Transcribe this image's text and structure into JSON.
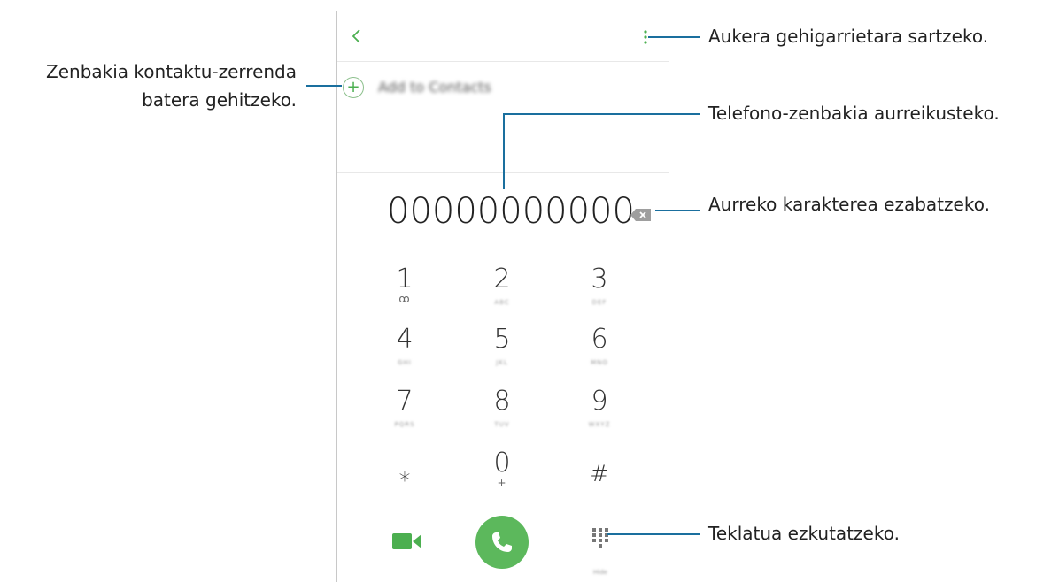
{
  "dialer": {
    "add_to_contacts_label": "Add to Contacts",
    "number": "00000000000",
    "keys": [
      {
        "digit": "1",
        "sub": "ꝏ"
      },
      {
        "digit": "2",
        "sub": "ABC"
      },
      {
        "digit": "3",
        "sub": "DEF"
      },
      {
        "digit": "4",
        "sub": "GHI"
      },
      {
        "digit": "5",
        "sub": "JKL"
      },
      {
        "digit": "6",
        "sub": "MNO"
      },
      {
        "digit": "7",
        "sub": "PQRS"
      },
      {
        "digit": "8",
        "sub": "TUV"
      },
      {
        "digit": "9",
        "sub": "WXYZ"
      },
      {
        "digit": "⁎",
        "sub": ""
      },
      {
        "digit": "0",
        "sub": "+"
      },
      {
        "digit": "#",
        "sub": ""
      }
    ],
    "keypad_sub": "Hide",
    "accent_color": "#5cb85c"
  },
  "callouts": {
    "more_options": "Aukera gehigarrietara sartzeko.",
    "add_contact_line1": "Zenbakia kontaktu-zerrenda",
    "add_contact_line2": "batera gehitzeko.",
    "preview_number": "Telefono-zenbakia aurreikusteko.",
    "delete_char": "Aurreko karakterea ezabatzeko.",
    "hide_keypad": "Teklatua ezkutatzeko.",
    "line_color": "#1a6f9e"
  }
}
